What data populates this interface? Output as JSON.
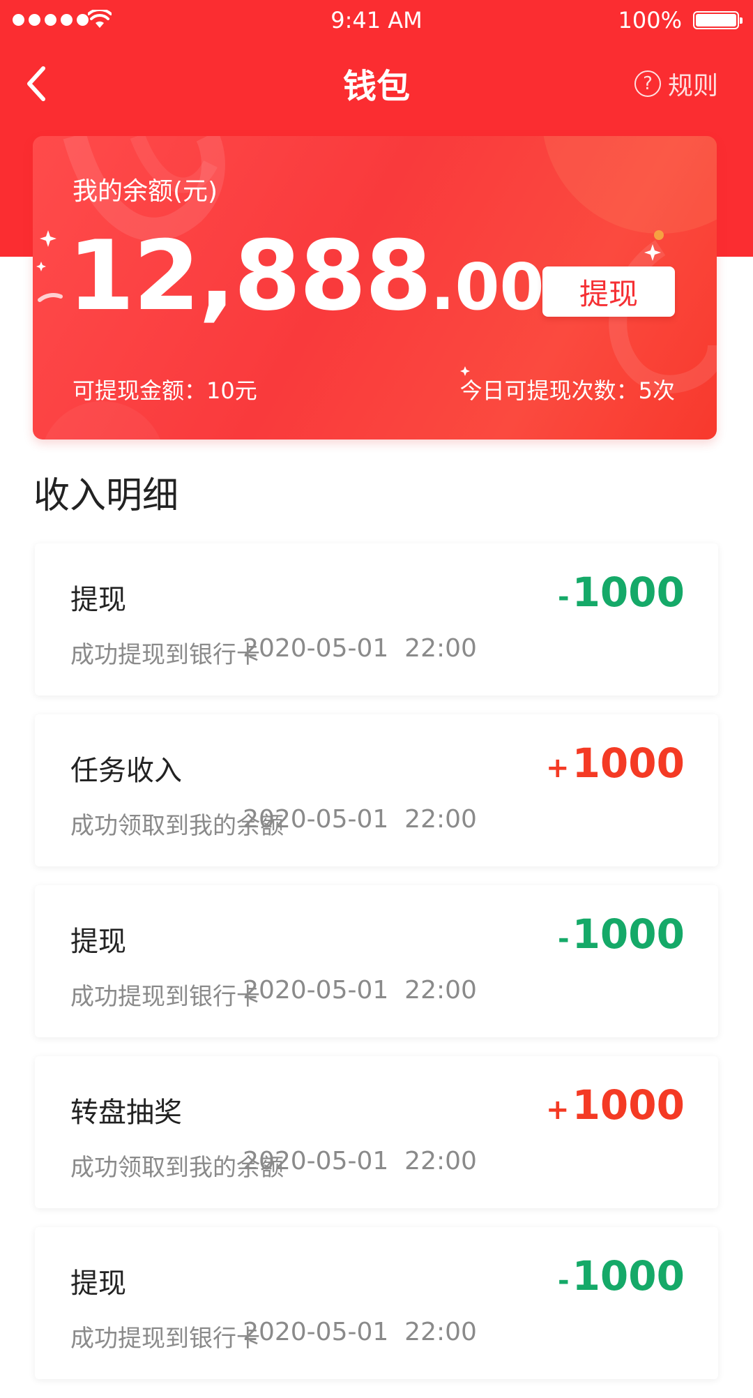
{
  "status_bar": {
    "time": "9:41 AM",
    "battery_pct": "100%"
  },
  "nav": {
    "title": "钱包",
    "rules_label": "规则",
    "rules_icon_glyph": "?"
  },
  "card": {
    "balance_label": "我的余额(元)",
    "balance_integer": "12,888",
    "balance_decimal": ".00",
    "withdraw_label": "提现",
    "withdrawable_amount": "可提现金额：10元",
    "withdraw_times_today": "今日可提现次数：5次"
  },
  "section_title": "收入明细",
  "transactions": [
    {
      "title": "提现",
      "desc": "成功提现到银行卡",
      "sign": "-",
      "amount": "1000",
      "time": "2020-05-01  22:00"
    },
    {
      "title": "任务收入",
      "desc": "成功领取到我的余额",
      "sign": "+",
      "amount": "1000",
      "time": "2020-05-01  22:00"
    },
    {
      "title": "提现",
      "desc": "成功提现到银行卡",
      "sign": "-",
      "amount": "1000",
      "time": "2020-05-01  22:00"
    },
    {
      "title": "转盘抽奖",
      "desc": "成功领取到我的余额",
      "sign": "+",
      "amount": "1000",
      "time": "2020-05-01  22:00"
    },
    {
      "title": "提现",
      "desc": "成功提现到银行卡",
      "sign": "-",
      "amount": "1000",
      "time": "2020-05-01  22:00"
    }
  ],
  "colors": {
    "brand_red": "#fb2d31",
    "negative_green": "#15a968",
    "positive_red": "#f43a24"
  }
}
